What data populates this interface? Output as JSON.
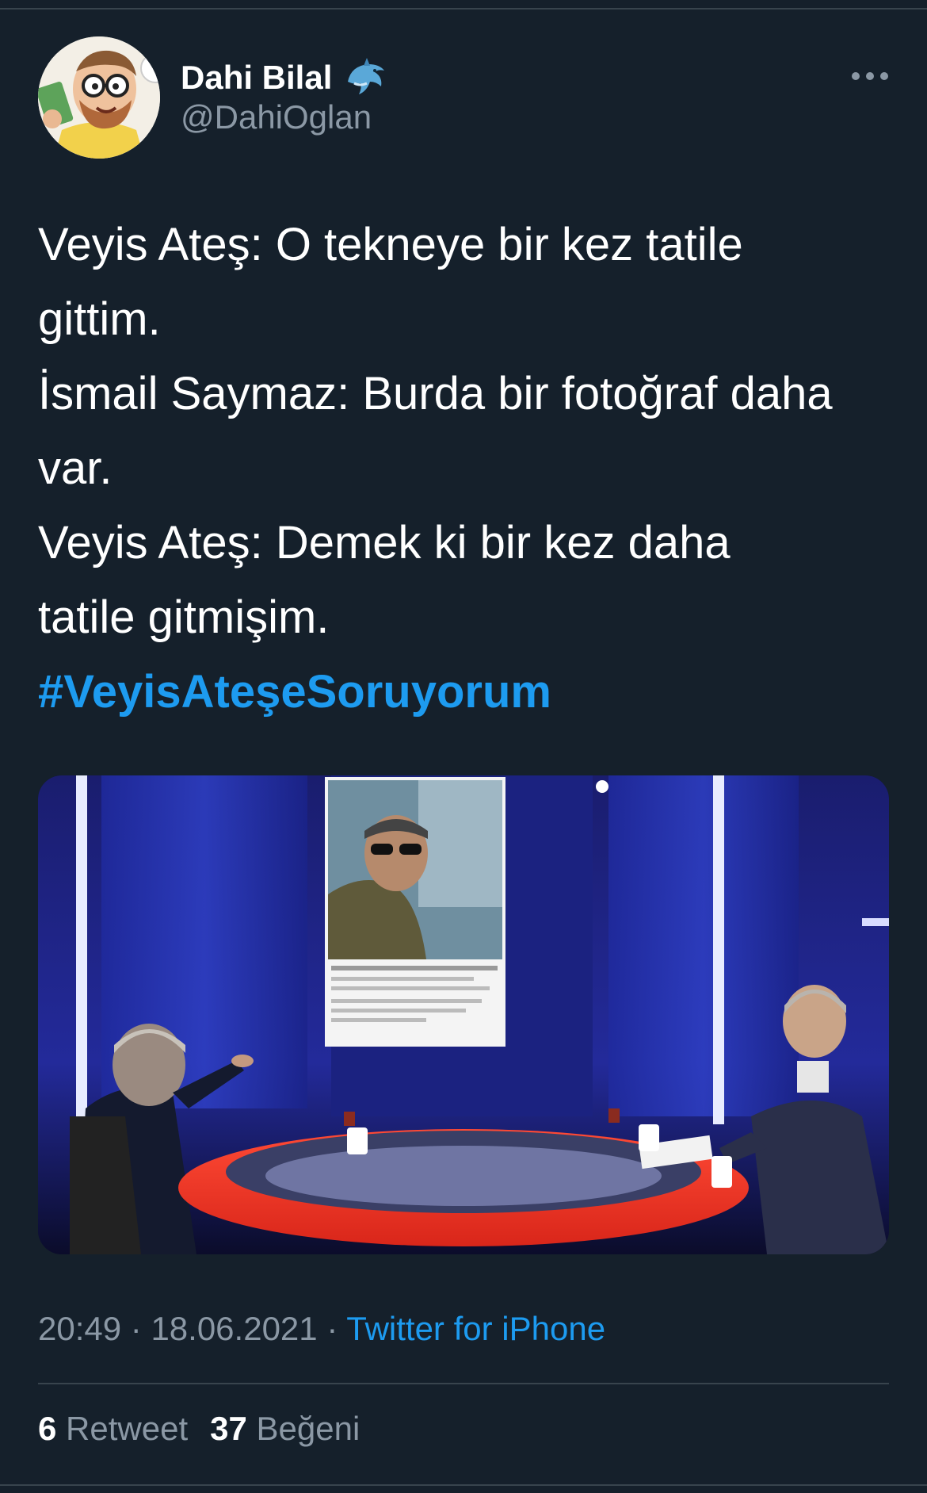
{
  "author": {
    "display_name": "Dahi Bilal",
    "handle": "@DahiOglan",
    "badge_icon": "dolphin-emoji-icon",
    "avatar_icon": "cartoon-avatar"
  },
  "more_icon": "more-horizontal-icon",
  "tweet": {
    "lines": [
      "Veyis Ateş: O tekneye bir kez tatile",
      "gittim.",
      "İsmail Saymaz: Burda bir fotoğraf daha",
      "var.",
      "Veyis Ateş: Demek ki bir kez daha",
      "tatile gitmişim."
    ],
    "hashtag": "#VeyisAteşeSoruyorum",
    "hashtag_color": "#1d9bf0"
  },
  "media": {
    "kind": "tv-studio-photo"
  },
  "meta": {
    "time": "20:49",
    "separator": " · ",
    "date": "18.06.2021",
    "source": "Twitter for iPhone"
  },
  "stats": {
    "retweets_count": "6",
    "retweets_label": "Retweet",
    "likes_count": "37",
    "likes_label": "Beğeni"
  },
  "colors": {
    "background": "#15202b",
    "text": "#ffffff",
    "secondary_text": "#8b98a5",
    "accent": "#1d9bf0",
    "divider": "#38444d"
  }
}
